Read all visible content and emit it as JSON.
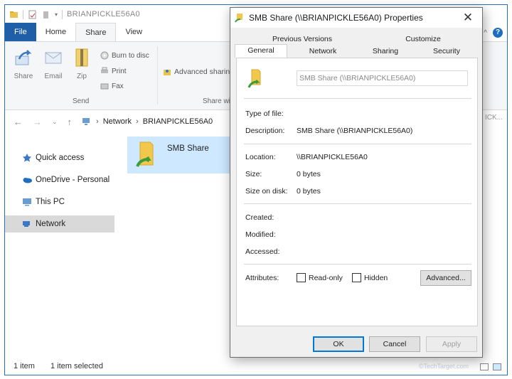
{
  "explorer": {
    "title": "BRIANPICKLE56A0",
    "ribbon_tabs": [
      "File",
      "Home",
      "Share",
      "View"
    ],
    "share_buttons": {
      "share": "Share",
      "email": "Email",
      "zip": "Zip"
    },
    "send_small": {
      "burn": "Burn to disc",
      "print": "Print",
      "fax": "Fax"
    },
    "advanced_sharing": "Advanced sharing",
    "group_send": "Send",
    "group_share_with": "Share wi",
    "breadcrumb": [
      "Network",
      "BRIANPICKLE56A0"
    ],
    "search_stub": "ICK...",
    "nav": [
      "Quick access",
      "OneDrive - Personal",
      "This PC",
      "Network"
    ],
    "item_name": "SMB Share",
    "status_count": "1 item",
    "status_selected": "1 item selected",
    "watermark": "©TechTarget.com"
  },
  "dialog": {
    "title": "SMB Share (\\\\BRIANPICKLE56A0) Properties",
    "tabs_top": [
      "Previous Versions",
      "Customize"
    ],
    "tabs_bottom": [
      "General",
      "Network",
      "Sharing",
      "Security"
    ],
    "name_value": "SMB Share (\\\\BRIANPICKLE56A0)",
    "labels": {
      "type": "Type of file:",
      "description": "Description:",
      "location": "Location:",
      "size": "Size:",
      "size_on_disk": "Size on disk:",
      "created": "Created:",
      "modified": "Modified:",
      "accessed": "Accessed:",
      "attributes": "Attributes:"
    },
    "values": {
      "description": "SMB Share (\\\\BRIANPICKLE56A0)",
      "location": "\\\\BRIANPICKLE56A0",
      "size": "0 bytes",
      "size_on_disk": "0 bytes"
    },
    "readonly": "Read-only",
    "hidden": "Hidden",
    "advanced": "Advanced...",
    "ok": "OK",
    "cancel": "Cancel",
    "apply": "Apply"
  },
  "colors": {
    "accent": "#1f5fa8",
    "selection": "#cde8ff",
    "nav_selected": "#d9d9d9",
    "help": "#1f6fc1"
  },
  "icons": [
    "folder-share-icon",
    "share-icon",
    "email-icon",
    "zip-icon",
    "burn-icon",
    "print-icon",
    "fax-icon",
    "quick-access-icon",
    "onedrive-icon",
    "pc-icon",
    "network-icon",
    "close-icon",
    "help-icon"
  ]
}
